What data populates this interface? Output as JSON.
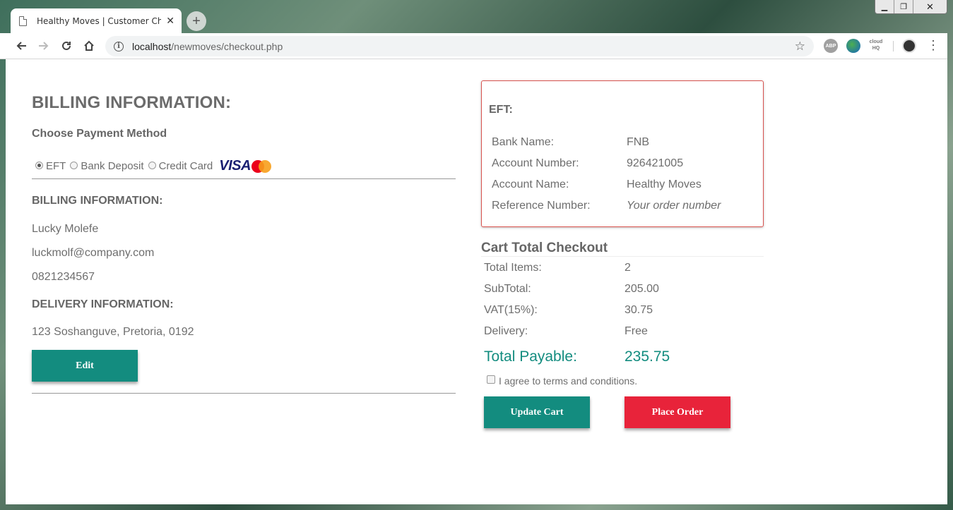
{
  "browser": {
    "tab_title": "Healthy Moves | Customer Checkout",
    "tab_close": "✕",
    "new_tab": "+",
    "url_host": "localhost",
    "url_path": "/newmoves/checkout.php",
    "window_min": "▁",
    "window_max": "❐",
    "window_close": "✕",
    "ext_abp": "ABP",
    "ext_cloud": "cloud HQ"
  },
  "billing": {
    "heading": "BILLING INFORMATION:",
    "choose_label": "Choose Payment Method",
    "payment_options": [
      {
        "label": "EFT",
        "checked": true
      },
      {
        "label": "Bank Deposit",
        "checked": false
      },
      {
        "label": "Credit Card",
        "checked": false
      }
    ],
    "card_brand": "VISA",
    "sub_heading": "BILLING INFORMATION:",
    "name": "Lucky Molefe",
    "email": "luckmolf@company.com",
    "phone": "0821234567",
    "delivery_heading": "DELIVERY INFORMATION:",
    "address": "123 Soshanguve, Pretoria, 0192",
    "edit_label": "Edit"
  },
  "eft": {
    "title": "EFT:",
    "rows": [
      {
        "key": "Bank Name:",
        "value": "FNB"
      },
      {
        "key": "Account Number:",
        "value": "926421005"
      },
      {
        "key": "Account Name:",
        "value": "Healthy Moves"
      },
      {
        "key": "Reference Number:",
        "value": "Your order number"
      }
    ]
  },
  "cart": {
    "title": "Cart Total Checkout",
    "rows": [
      {
        "key": "Total Items:",
        "value": "2"
      },
      {
        "key": "SubTotal:",
        "value": "205.00"
      },
      {
        "key": "VAT(15%):",
        "value": "30.75"
      },
      {
        "key": "Delivery:",
        "value": "Free"
      }
    ],
    "total_label": "Total Payable:",
    "total_value": "235.75",
    "agree_label": "I agree to terms and conditions.",
    "update_label": "Update Cart",
    "place_label": "Place Order"
  },
  "colors": {
    "accent_teal": "#138c7f",
    "accent_red": "#e8233a",
    "eft_border": "#d9534f"
  }
}
